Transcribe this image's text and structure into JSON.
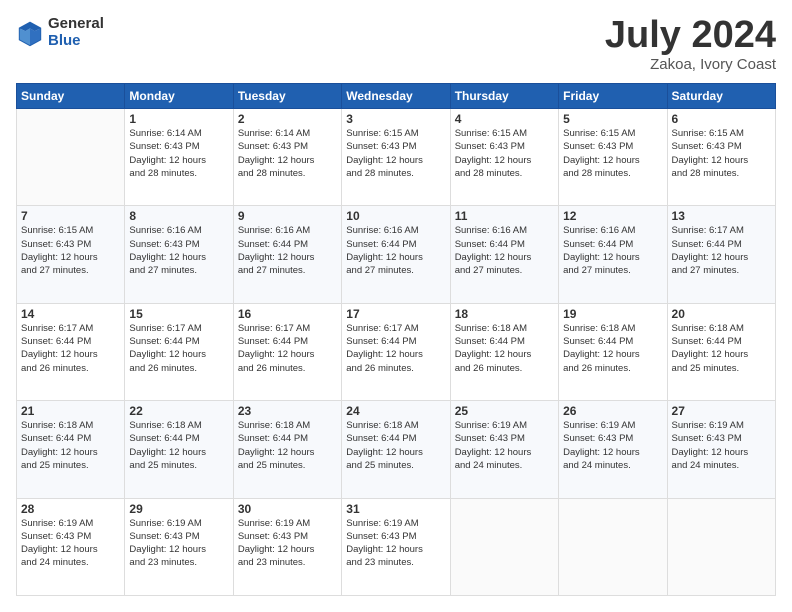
{
  "header": {
    "logo_general": "General",
    "logo_blue": "Blue",
    "title": "July 2024",
    "location": "Zakoa, Ivory Coast"
  },
  "days_of_week": [
    "Sunday",
    "Monday",
    "Tuesday",
    "Wednesday",
    "Thursday",
    "Friday",
    "Saturday"
  ],
  "weeks": [
    [
      {
        "day": "",
        "info": ""
      },
      {
        "day": "1",
        "info": "Sunrise: 6:14 AM\nSunset: 6:43 PM\nDaylight: 12 hours\nand 28 minutes."
      },
      {
        "day": "2",
        "info": "Sunrise: 6:14 AM\nSunset: 6:43 PM\nDaylight: 12 hours\nand 28 minutes."
      },
      {
        "day": "3",
        "info": "Sunrise: 6:15 AM\nSunset: 6:43 PM\nDaylight: 12 hours\nand 28 minutes."
      },
      {
        "day": "4",
        "info": "Sunrise: 6:15 AM\nSunset: 6:43 PM\nDaylight: 12 hours\nand 28 minutes."
      },
      {
        "day": "5",
        "info": "Sunrise: 6:15 AM\nSunset: 6:43 PM\nDaylight: 12 hours\nand 28 minutes."
      },
      {
        "day": "6",
        "info": "Sunrise: 6:15 AM\nSunset: 6:43 PM\nDaylight: 12 hours\nand 28 minutes."
      }
    ],
    [
      {
        "day": "7",
        "info": ""
      },
      {
        "day": "8",
        "info": "Sunrise: 6:16 AM\nSunset: 6:43 PM\nDaylight: 12 hours\nand 27 minutes."
      },
      {
        "day": "9",
        "info": "Sunrise: 6:16 AM\nSunset: 6:44 PM\nDaylight: 12 hours\nand 27 minutes."
      },
      {
        "day": "10",
        "info": "Sunrise: 6:16 AM\nSunset: 6:44 PM\nDaylight: 12 hours\nand 27 minutes."
      },
      {
        "day": "11",
        "info": "Sunrise: 6:16 AM\nSunset: 6:44 PM\nDaylight: 12 hours\nand 27 minutes."
      },
      {
        "day": "12",
        "info": "Sunrise: 6:16 AM\nSunset: 6:44 PM\nDaylight: 12 hours\nand 27 minutes."
      },
      {
        "day": "13",
        "info": "Sunrise: 6:17 AM\nSunset: 6:44 PM\nDaylight: 12 hours\nand 27 minutes."
      }
    ],
    [
      {
        "day": "14",
        "info": ""
      },
      {
        "day": "15",
        "info": "Sunrise: 6:17 AM\nSunset: 6:44 PM\nDaylight: 12 hours\nand 26 minutes."
      },
      {
        "day": "16",
        "info": "Sunrise: 6:17 AM\nSunset: 6:44 PM\nDaylight: 12 hours\nand 26 minutes."
      },
      {
        "day": "17",
        "info": "Sunrise: 6:17 AM\nSunset: 6:44 PM\nDaylight: 12 hours\nand 26 minutes."
      },
      {
        "day": "18",
        "info": "Sunrise: 6:18 AM\nSunset: 6:44 PM\nDaylight: 12 hours\nand 26 minutes."
      },
      {
        "day": "19",
        "info": "Sunrise: 6:18 AM\nSunset: 6:44 PM\nDaylight: 12 hours\nand 26 minutes."
      },
      {
        "day": "20",
        "info": "Sunrise: 6:18 AM\nSunset: 6:44 PM\nDaylight: 12 hours\nand 25 minutes."
      }
    ],
    [
      {
        "day": "21",
        "info": ""
      },
      {
        "day": "22",
        "info": "Sunrise: 6:18 AM\nSunset: 6:44 PM\nDaylight: 12 hours\nand 25 minutes."
      },
      {
        "day": "23",
        "info": "Sunrise: 6:18 AM\nSunset: 6:44 PM\nDaylight: 12 hours\nand 25 minutes."
      },
      {
        "day": "24",
        "info": "Sunrise: 6:18 AM\nSunset: 6:44 PM\nDaylight: 12 hours\nand 25 minutes."
      },
      {
        "day": "25",
        "info": "Sunrise: 6:19 AM\nSunset: 6:43 PM\nDaylight: 12 hours\nand 24 minutes."
      },
      {
        "day": "26",
        "info": "Sunrise: 6:19 AM\nSunset: 6:43 PM\nDaylight: 12 hours\nand 24 minutes."
      },
      {
        "day": "27",
        "info": "Sunrise: 6:19 AM\nSunset: 6:43 PM\nDaylight: 12 hours\nand 24 minutes."
      }
    ],
    [
      {
        "day": "28",
        "info": "Sunrise: 6:19 AM\nSunset: 6:43 PM\nDaylight: 12 hours\nand 24 minutes."
      },
      {
        "day": "29",
        "info": "Sunrise: 6:19 AM\nSunset: 6:43 PM\nDaylight: 12 hours\nand 23 minutes."
      },
      {
        "day": "30",
        "info": "Sunrise: 6:19 AM\nSunset: 6:43 PM\nDaylight: 12 hours\nand 23 minutes."
      },
      {
        "day": "31",
        "info": "Sunrise: 6:19 AM\nSunset: 6:43 PM\nDaylight: 12 hours\nand 23 minutes."
      },
      {
        "day": "",
        "info": ""
      },
      {
        "day": "",
        "info": ""
      },
      {
        "day": "",
        "info": ""
      }
    ]
  ],
  "week7_sunday": "Sunrise: 6:15 AM\nSunset: 6:43 PM\nDaylight: 12 hours\nand 28 minutes.",
  "week2_sunday": "Sunrise: 6:15 AM\nSunset: 6:43 PM\nDaylight: 12 hours\nand 27 minutes.",
  "week3_sunday": "Sunrise: 6:17 AM\nSunset: 6:44 PM\nDaylight: 12 hours\nand 26 minutes.",
  "week4_sunday": "Sunrise: 6:18 AM\nSunset: 6:44 PM\nDaylight: 12 hours\nand 25 minutes."
}
